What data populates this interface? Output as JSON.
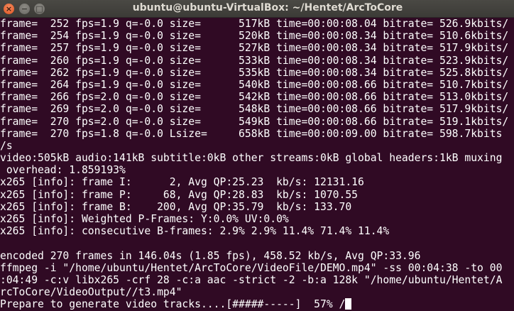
{
  "window": {
    "title": "ubuntu@ubuntu-VirtualBox: ~/Hentet/ArcToCore",
    "controls": {
      "close": "×",
      "minimize": "−",
      "maximize": "□"
    }
  },
  "colors": {
    "background": "#300a24",
    "text": "#ffffff",
    "close_button": "#e95420"
  },
  "terminal": {
    "lines": [
      "frame=  252 fps=1.9 q=-0.0 size=      517kB time=00:00:08.04 bitrate= 526.9kbits/",
      "frame=  254 fps=1.9 q=-0.0 size=      520kB time=00:00:08.34 bitrate= 510.6kbits/",
      "frame=  257 fps=1.9 q=-0.0 size=      527kB time=00:00:08.34 bitrate= 517.9kbits/",
      "frame=  260 fps=1.9 q=-0.0 size=      533kB time=00:00:08.34 bitrate= 523.9kbits/",
      "frame=  262 fps=1.9 q=-0.0 size=      535kB time=00:00:08.34 bitrate= 525.8kbits/",
      "frame=  264 fps=1.9 q=-0.0 size=      540kB time=00:00:08.66 bitrate= 510.7kbits/",
      "frame=  266 fps=2.0 q=-0.0 size=      542kB time=00:00:08.66 bitrate= 513.0kbits/",
      "frame=  269 fps=2.0 q=-0.0 size=      548kB time=00:00:08.66 bitrate= 517.9kbits/",
      "frame=  270 fps=2.0 q=-0.0 size=      549kB time=00:00:08.66 bitrate= 519.1kbits/",
      "frame=  270 fps=1.8 q=-0.0 Lsize=     658kB time=00:00:09.00 bitrate= 598.7kbits",
      "/s",
      "video:505kB audio:141kB subtitle:0kB other streams:0kB global headers:1kB muxing",
      " overhead: 1.859193%",
      "x265 [info]: frame I:      2, Avg QP:25.23  kb/s: 12131.16",
      "x265 [info]: frame P:     68, Avg QP:28.83  kb/s: 1070.55",
      "x265 [info]: frame B:    200, Avg QP:35.79  kb/s: 133.70",
      "x265 [info]: Weighted P-Frames: Y:0.0% UV:0.0%",
      "x265 [info]: consecutive B-frames: 2.9% 2.9% 11.4% 71.4% 11.4%",
      "",
      "encoded 270 frames in 146.04s (1.85 fps), 458.52 kb/s, Avg QP:33.96",
      "ffmpeg -i \"/home/ubuntu/Hentet/ArcToCore/VideoFile/DEMO.mp4\" -ss 00:04:38 -to 00",
      ":04:49 -c:v libx265 -crf 28 -c:a aac -strict -2 -b:a 128k \"/home/ubuntu/Hentet/A",
      "rcToCore/VideoOutput//t3.mp4\""
    ],
    "prompt_line": "Prepare to generate video tracks....[#####-----]  57% /",
    "progress_percent": 57
  }
}
